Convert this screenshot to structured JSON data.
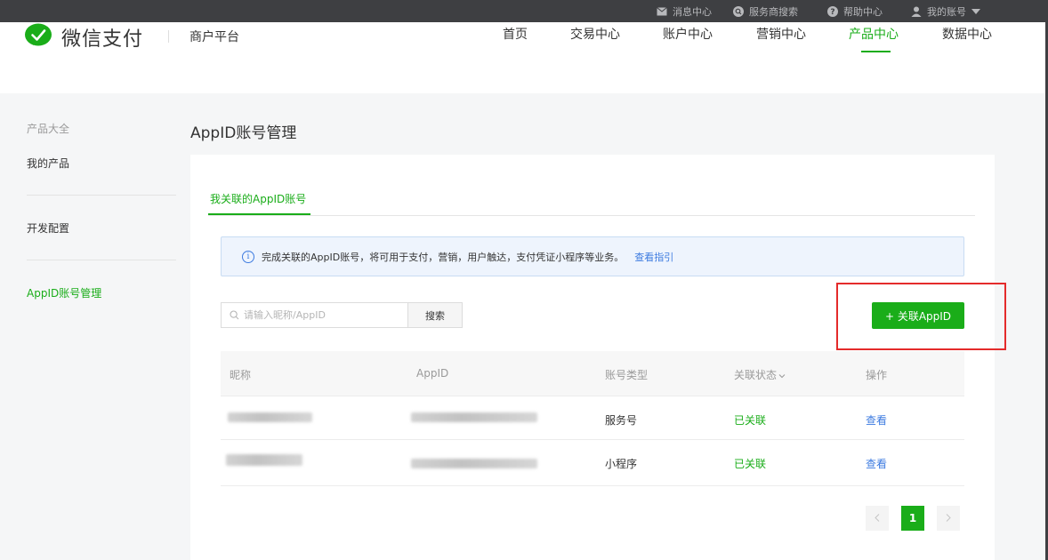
{
  "topbar": {
    "items": [
      {
        "label": "消息中心",
        "icon": "mail-icon"
      },
      {
        "label": "服务商搜索",
        "icon": "search-icon"
      },
      {
        "label": "帮助中心",
        "icon": "help-icon"
      },
      {
        "label": "我的账号",
        "icon": "user-icon"
      }
    ]
  },
  "header": {
    "logo_text": "微信支付",
    "platform": "商户平台",
    "nav": [
      "首页",
      "交易中心",
      "账户中心",
      "营销中心",
      "产品中心",
      "数据中心"
    ],
    "active_nav": "产品中心"
  },
  "sidebar": {
    "category": "产品大全",
    "items": [
      "我的产品",
      "开发配置",
      "AppID账号管理"
    ],
    "active": "AppID账号管理"
  },
  "main": {
    "title": "AppID账号管理",
    "tab": "我关联的AppID账号",
    "notice_text": "完成关联的AppID账号，将可用于支付，营销，用户触达，支付凭证小程序等业务。",
    "notice_link": "查看指引",
    "search_placeholder": "请输入昵称/AppID",
    "search_button": "搜索",
    "add_button": "+ 关联AppID",
    "table": {
      "headers": [
        "昵称",
        "AppID",
        "账号类型",
        "关联状态",
        "操作"
      ],
      "rows": [
        {
          "type": "服务号",
          "status": "已关联",
          "action": "查看"
        },
        {
          "type": "小程序",
          "status": "已关联",
          "action": "查看"
        }
      ]
    },
    "pagination": {
      "current": "1"
    }
  },
  "colors": {
    "brand_green": "#1aad19",
    "link_blue": "#3d7be0",
    "highlight_red": "#e42b2b",
    "topbar": "#3e3f42"
  }
}
